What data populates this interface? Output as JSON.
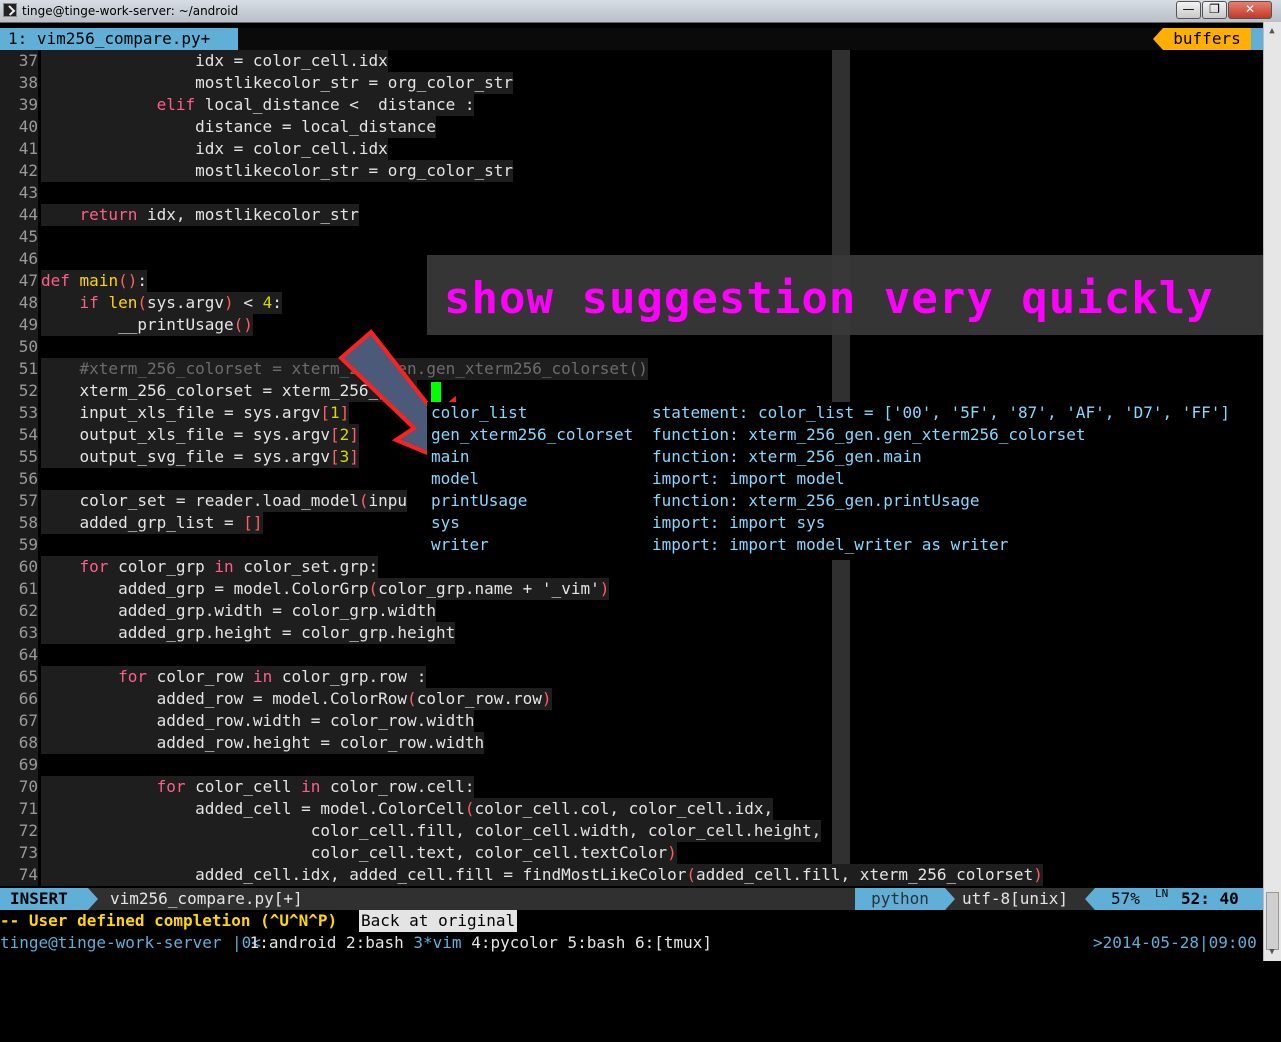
{
  "window": {
    "title": "tinge@tinge-work-server: ~/android",
    "buttons": {
      "minimize": "—",
      "maximize": "❐",
      "close": "✕"
    }
  },
  "tabline": {
    "current_tab": "1: vim256_compare.py+",
    "buffers_label": "buffers"
  },
  "editor": {
    "lines": [
      {
        "n": "37",
        "html": "                <span>idx = color_cell.idx</span>"
      },
      {
        "n": "38",
        "html": "                <span>mostlikecolor_str = org_color_str</span>"
      },
      {
        "n": "39",
        "html": "            <span class=\"kw\">elif</span> local_distance &lt;  distance :"
      },
      {
        "n": "40",
        "html": "                distance = local_distance"
      },
      {
        "n": "41",
        "html": "                idx = color_cell.idx"
      },
      {
        "n": "42",
        "html": "                mostlikecolor_str = org_color_str"
      },
      {
        "n": "43",
        "html": ""
      },
      {
        "n": "44",
        "html": "    <span class=\"kw\">return</span> idx, mostlikecolor_str"
      },
      {
        "n": "45",
        "html": ""
      },
      {
        "n": "46",
        "html": ""
      },
      {
        "n": "47",
        "html": "<span class=\"kw\">def</span> <span class=\"fn\">main</span><span class=\"paren\">()</span>:"
      },
      {
        "n": "48",
        "html": "    <span class=\"kw\">if</span> <span class=\"fn\">len</span><span class=\"paren\">(</span>sys.argv<span class=\"paren\">)</span> &lt; <span class=\"num\">4</span>:"
      },
      {
        "n": "49",
        "html": "        __printUsage<span class=\"paren\">()</span>"
      },
      {
        "n": "50",
        "html": ""
      },
      {
        "n": "51",
        "html": "    <span class=\"cmt\">#xterm_256_colorset = xterm_256_gen.gen_xterm256_colorset()</span>"
      },
      {
        "n": "52",
        "html": "    xterm_256_colorset = xterm_256_gen."
      },
      {
        "n": "53",
        "html": "    input_xls_file = sys.argv<span class=\"paren\">[</span><span class=\"num\">1</span><span class=\"paren\">]</span>"
      },
      {
        "n": "54",
        "html": "    output_xls_file = sys.argv<span class=\"paren\">[</span><span class=\"num\">2</span><span class=\"paren\">]</span>"
      },
      {
        "n": "55",
        "html": "    output_svg_file = sys.argv<span class=\"paren\">[</span><span class=\"num\">3</span><span class=\"paren\">]</span>"
      },
      {
        "n": "56",
        "html": ""
      },
      {
        "n": "57",
        "html": "    color_set = reader.load_model<span class=\"paren\">(</span>inpu"
      },
      {
        "n": "58",
        "html": "    added_grp_list = <span class=\"paren\">[]</span>"
      },
      {
        "n": "59",
        "html": ""
      },
      {
        "n": "60",
        "html": "    <span class=\"kw\">for</span> color_grp <span class=\"kw\">in</span> color_set.grp:"
      },
      {
        "n": "61",
        "html": "        added_grp = model.ColorGrp<span class=\"paren\">(</span>color_grp.name + <span class=\"str\">'_vim'</span><span class=\"paren\">)</span>"
      },
      {
        "n": "62",
        "html": "        added_grp.width = color_grp.width"
      },
      {
        "n": "63",
        "html": "        added_grp.height = color_grp.height"
      },
      {
        "n": "64",
        "html": ""
      },
      {
        "n": "65",
        "html": "        <span class=\"kw\">for</span> color_row <span class=\"kw\">in</span> color_grp.row :"
      },
      {
        "n": "66",
        "html": "            added_row = model.ColorRow<span class=\"paren\">(</span>color_row.row<span class=\"paren\">)</span>"
      },
      {
        "n": "67",
        "html": "            added_row.width = color_row.width"
      },
      {
        "n": "68",
        "html": "            added_row.height = color_row.width"
      },
      {
        "n": "69",
        "html": ""
      },
      {
        "n": "70",
        "html": "            <span class=\"kw\">for</span> color_cell <span class=\"kw\">in</span> color_row.cell:"
      },
      {
        "n": "71",
        "html": "                added_cell = model.ColorCell<span class=\"paren\">(</span>color_cell.col, color_cell.idx,"
      },
      {
        "n": "72",
        "html": "                            color_cell.fill, color_cell.width, color_cell.height,"
      },
      {
        "n": "73",
        "html": "                            color_cell.text, color_cell.textColor<span class=\"paren\">)</span>"
      },
      {
        "n": "74",
        "html": "                added_cell.idx, added_cell.fill = findMostLikeColor<span class=\"paren\">(</span>added_cell.fill, xterm_256_colorset<span class=\"paren\">)</span>"
      }
    ]
  },
  "annotation": {
    "text": "show suggestion very quickly",
    "color": "#ff00ff"
  },
  "completion_popup": {
    "items": [
      {
        "word": "color_list",
        "info": "statement: color_list = ['00', '5F', '87', 'AF', 'D7', 'FF']"
      },
      {
        "word": "gen_xterm256_colorset",
        "info": "function: xterm_256_gen.gen_xterm256_colorset"
      },
      {
        "word": "main",
        "info": "function: xterm_256_gen.main"
      },
      {
        "word": "model",
        "info": "import: import model"
      },
      {
        "word": "printUsage",
        "info": "function: xterm_256_gen.printUsage"
      },
      {
        "word": "sys",
        "info": "import: import sys"
      },
      {
        "word": "writer",
        "info": "import: import model_writer as writer"
      }
    ]
  },
  "statusline": {
    "mode": "INSERT",
    "file": "vim256_compare.py[+]",
    "filetype": "python",
    "encoding": "utf-8[unix]",
    "percent": "57%",
    "line_symbol": "LN",
    "position": "52: 40"
  },
  "cmdline": {
    "message": "-- User defined completion (^U^N^P)",
    "extra": "Back at original"
  },
  "tmux": {
    "host": "tinge@tinge-work-server",
    "separator": "|0<",
    "windows_before": " 1:android 2:bash ",
    "current_window": "3*vim",
    "windows_after": " 4:pycolor 5:bash 6:[tmux]",
    "datetime": ">2014-05-28|09:00"
  },
  "colors": {
    "accent": "#5fafd7",
    "buffers": "#ffaf00",
    "cursor": "#00ff00"
  }
}
